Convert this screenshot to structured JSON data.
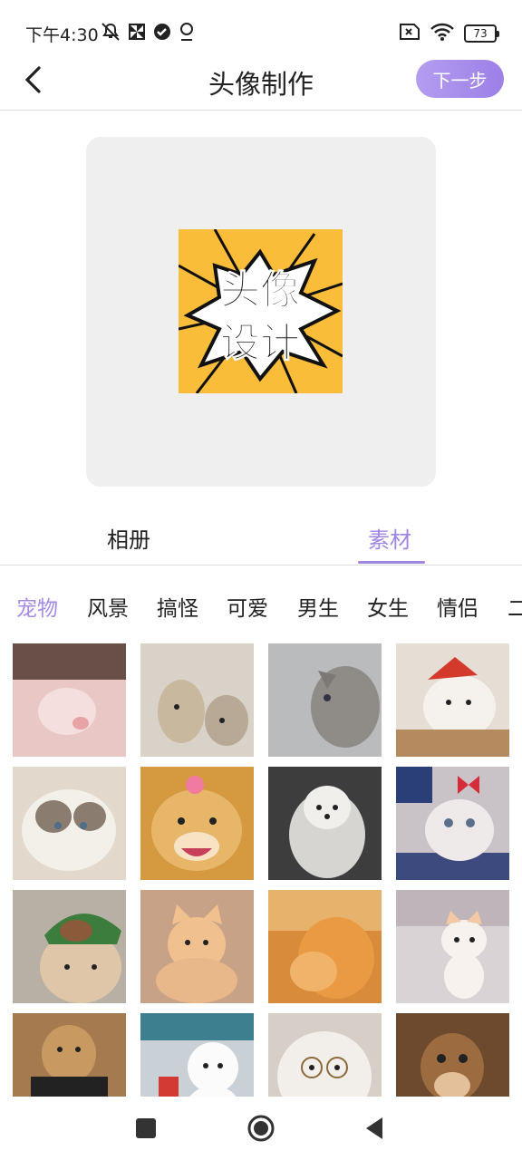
{
  "status_bar": {
    "time": "下午4:30",
    "left_icons": [
      "bell-off-icon",
      "pinwheel-icon",
      "check-badge-icon",
      "location-pin-icon"
    ],
    "right_icons": [
      "sim-x-icon",
      "wifi-icon"
    ],
    "battery": "73"
  },
  "header": {
    "title": "头像制作",
    "next_label": "下一步"
  },
  "preview": {
    "line1": "头像",
    "line2": "设计",
    "bg_color": "#f9bd3a"
  },
  "source_tabs": [
    {
      "label": "相册",
      "active": false
    },
    {
      "label": "素材",
      "active": true
    }
  ],
  "categories": [
    {
      "label": "宠物",
      "active": true
    },
    {
      "label": "风景",
      "active": false
    },
    {
      "label": "搞怪",
      "active": false
    },
    {
      "label": "可爱",
      "active": false
    },
    {
      "label": "男生",
      "active": false
    },
    {
      "label": "女生",
      "active": false
    },
    {
      "label": "情侣",
      "active": false
    },
    {
      "label": "二",
      "active": false
    }
  ],
  "thumbnails": [
    {
      "name": "thumb-pink-pig",
      "color": "#e9c7c4"
    },
    {
      "name": "thumb-hedgehogs",
      "color": "#d9d2c8"
    },
    {
      "name": "thumb-gray-cat",
      "color": "#b9bbbd"
    },
    {
      "name": "thumb-santa-cat",
      "color": "#e6ddd4"
    },
    {
      "name": "thumb-ragdoll-cat",
      "color": "#e2d8cc"
    },
    {
      "name": "thumb-shiba-dog",
      "color": "#d59a3f"
    },
    {
      "name": "thumb-white-dog-blanket",
      "color": "#9a9a9a"
    },
    {
      "name": "thumb-bow-cat",
      "color": "#c9c3c8"
    },
    {
      "name": "thumb-bulldog-hat",
      "color": "#b8b0a5"
    },
    {
      "name": "thumb-orange-cat",
      "color": "#c8a287"
    },
    {
      "name": "thumb-hugging-cat",
      "color": "#d88c3b"
    },
    {
      "name": "thumb-white-kitten",
      "color": "#d9d3d6"
    },
    {
      "name": "thumb-dog-shirt",
      "color": "#a57a4e"
    },
    {
      "name": "thumb-white-puppy",
      "color": "#c9d0d6"
    },
    {
      "name": "thumb-glasses-cat",
      "color": "#d6cec7"
    },
    {
      "name": "thumb-chipmunk",
      "color": "#6d4a2e"
    }
  ],
  "nav": [
    "recents-button",
    "home-button",
    "back-nav-button"
  ]
}
